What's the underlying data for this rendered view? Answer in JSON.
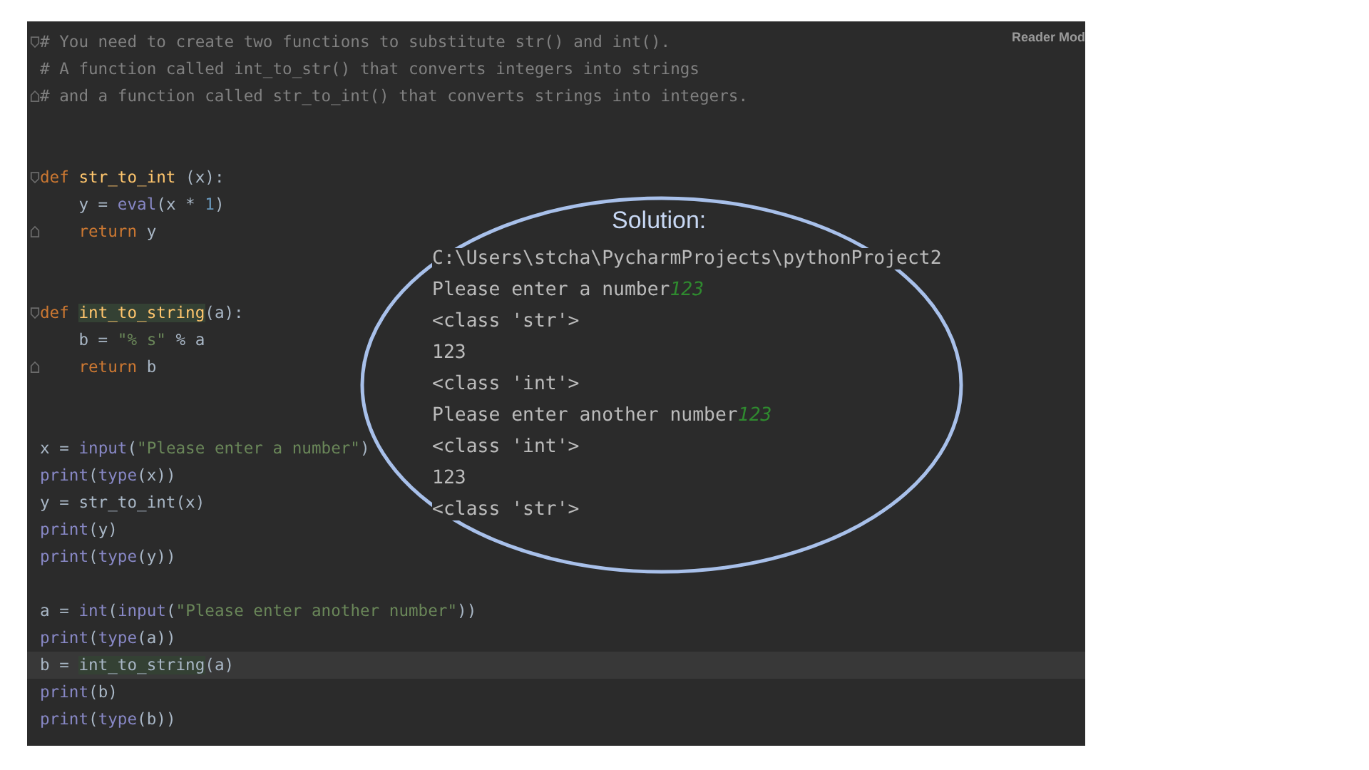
{
  "editor": {
    "reader_mode": "Reader Mod",
    "lines": [
      {
        "fold_start": true,
        "fold_end": false,
        "current": false,
        "segments": [
          {
            "kind": "comment",
            "text": "# You need to create two functions to substitute str() and int()."
          }
        ]
      },
      {
        "fold_start": false,
        "fold_end": false,
        "current": false,
        "segments": [
          {
            "kind": "comment",
            "text": "# A function called int_to_str() that converts integers into strings"
          }
        ]
      },
      {
        "fold_start": false,
        "fold_end": true,
        "current": false,
        "segments": [
          {
            "kind": "comment",
            "text": "# and a function called str_to_int() that converts strings into integers."
          }
        ]
      },
      {
        "fold_start": false,
        "fold_end": false,
        "current": false
      },
      {
        "fold_start": false,
        "fold_end": false,
        "current": false
      },
      {
        "fold_start": true,
        "fold_end": false,
        "current": false,
        "segments": [
          {
            "kind": "keyword",
            "text": "def "
          },
          {
            "kind": "fn_def",
            "text": "str_to_int"
          },
          {
            "kind": "plain",
            "text": " (x):"
          }
        ]
      },
      {
        "fold_start": false,
        "fold_end": false,
        "current": false,
        "segments": [
          {
            "kind": "plain",
            "text": "    y = "
          },
          {
            "kind": "builtin",
            "text": "eval"
          },
          {
            "kind": "plain",
            "text": "(x * "
          },
          {
            "kind": "number",
            "text": "1"
          },
          {
            "kind": "plain",
            "text": ")"
          }
        ]
      },
      {
        "fold_start": false,
        "fold_end": true,
        "current": false,
        "segments": [
          {
            "kind": "keyword",
            "text": "    return"
          },
          {
            "kind": "plain",
            "text": " y"
          }
        ]
      },
      {
        "fold_start": false,
        "fold_end": false,
        "current": false
      },
      {
        "fold_start": false,
        "fold_end": false,
        "current": false
      },
      {
        "fold_start": true,
        "fold_end": false,
        "current": false,
        "segments": [
          {
            "kind": "keyword",
            "text": "def "
          },
          {
            "kind": "fn_def_usage",
            "text": "int_to_string"
          },
          {
            "kind": "plain",
            "text": "(a):"
          }
        ]
      },
      {
        "fold_start": false,
        "fold_end": false,
        "current": false,
        "segments": [
          {
            "kind": "plain",
            "text": "    b = "
          },
          {
            "kind": "string",
            "text": "\"% s\""
          },
          {
            "kind": "plain",
            "text": " % a"
          }
        ]
      },
      {
        "fold_start": false,
        "fold_end": true,
        "current": false,
        "segments": [
          {
            "kind": "keyword",
            "text": "    return"
          },
          {
            "kind": "plain",
            "text": " b"
          }
        ]
      },
      {
        "fold_start": false,
        "fold_end": false,
        "current": false
      },
      {
        "fold_start": false,
        "fold_end": false,
        "current": false
      },
      {
        "fold_start": false,
        "fold_end": false,
        "current": false,
        "segments": [
          {
            "kind": "plain",
            "text": "x = "
          },
          {
            "kind": "builtin",
            "text": "input"
          },
          {
            "kind": "plain",
            "text": "("
          },
          {
            "kind": "string",
            "text": "\"Please enter a number\""
          },
          {
            "kind": "plain",
            "text": ")"
          }
        ]
      },
      {
        "fold_start": false,
        "fold_end": false,
        "current": false,
        "segments": [
          {
            "kind": "builtin",
            "text": "print"
          },
          {
            "kind": "plain",
            "text": "("
          },
          {
            "kind": "builtin",
            "text": "type"
          },
          {
            "kind": "plain",
            "text": "(x))"
          }
        ]
      },
      {
        "fold_start": false,
        "fold_end": false,
        "current": false,
        "segments": [
          {
            "kind": "plain",
            "text": "y = str_to_int(x)"
          }
        ]
      },
      {
        "fold_start": false,
        "fold_end": false,
        "current": false,
        "segments": [
          {
            "kind": "builtin",
            "text": "print"
          },
          {
            "kind": "plain",
            "text": "(y)"
          }
        ]
      },
      {
        "fold_start": false,
        "fold_end": false,
        "current": false,
        "segments": [
          {
            "kind": "builtin",
            "text": "print"
          },
          {
            "kind": "plain",
            "text": "("
          },
          {
            "kind": "builtin",
            "text": "type"
          },
          {
            "kind": "plain",
            "text": "(y))"
          }
        ]
      },
      {
        "fold_start": false,
        "fold_end": false,
        "current": false
      },
      {
        "fold_start": false,
        "fold_end": false,
        "current": false,
        "segments": [
          {
            "kind": "plain",
            "text": "a = "
          },
          {
            "kind": "builtin",
            "text": "int"
          },
          {
            "kind": "plain",
            "text": "("
          },
          {
            "kind": "builtin",
            "text": "input"
          },
          {
            "kind": "plain",
            "text": "("
          },
          {
            "kind": "string",
            "text": "\"Please enter another number\""
          },
          {
            "kind": "plain",
            "text": "))"
          }
        ]
      },
      {
        "fold_start": false,
        "fold_end": false,
        "current": false,
        "segments": [
          {
            "kind": "builtin",
            "text": "print"
          },
          {
            "kind": "plain",
            "text": "("
          },
          {
            "kind": "builtin",
            "text": "type"
          },
          {
            "kind": "plain",
            "text": "(a))"
          }
        ]
      },
      {
        "fold_start": false,
        "fold_end": false,
        "current": true,
        "segments": [
          {
            "kind": "plain",
            "text": "b = "
          },
          {
            "kind": "usage",
            "text": "int_to_string"
          },
          {
            "kind": "plain",
            "text": "(a)"
          }
        ]
      },
      {
        "fold_start": false,
        "fold_end": false,
        "current": false,
        "segments": [
          {
            "kind": "builtin",
            "text": "print"
          },
          {
            "kind": "plain",
            "text": "(b)"
          }
        ]
      },
      {
        "fold_start": false,
        "fold_end": false,
        "current": false,
        "segments": [
          {
            "kind": "builtin",
            "text": "print"
          },
          {
            "kind": "plain",
            "text": "("
          },
          {
            "kind": "builtin",
            "text": "type"
          },
          {
            "kind": "plain",
            "text": "(b))"
          }
        ]
      }
    ]
  },
  "annotation": {
    "label": "Solution:",
    "console_lines": [
      {
        "segments": [
          {
            "kind": "output",
            "text": "C:\\Users\\stcha\\PycharmProjects\\pythonProject2"
          }
        ]
      },
      {
        "segments": [
          {
            "kind": "output",
            "text": "Please enter a number"
          },
          {
            "kind": "input",
            "text": "123"
          }
        ]
      },
      {
        "segments": [
          {
            "kind": "output",
            "text": "<class 'str'>"
          }
        ]
      },
      {
        "segments": [
          {
            "kind": "output",
            "text": "123"
          }
        ]
      },
      {
        "segments": [
          {
            "kind": "output",
            "text": "<class 'int'>"
          }
        ]
      },
      {
        "segments": [
          {
            "kind": "output",
            "text": "Please enter another number"
          },
          {
            "kind": "input",
            "text": "123"
          }
        ]
      },
      {
        "segments": [
          {
            "kind": "output",
            "text": "<class 'int'>"
          }
        ]
      },
      {
        "segments": [
          {
            "kind": "output",
            "text": "123"
          }
        ]
      },
      {
        "segments": [
          {
            "kind": "output",
            "text": "<class 'str'>"
          }
        ]
      }
    ]
  }
}
